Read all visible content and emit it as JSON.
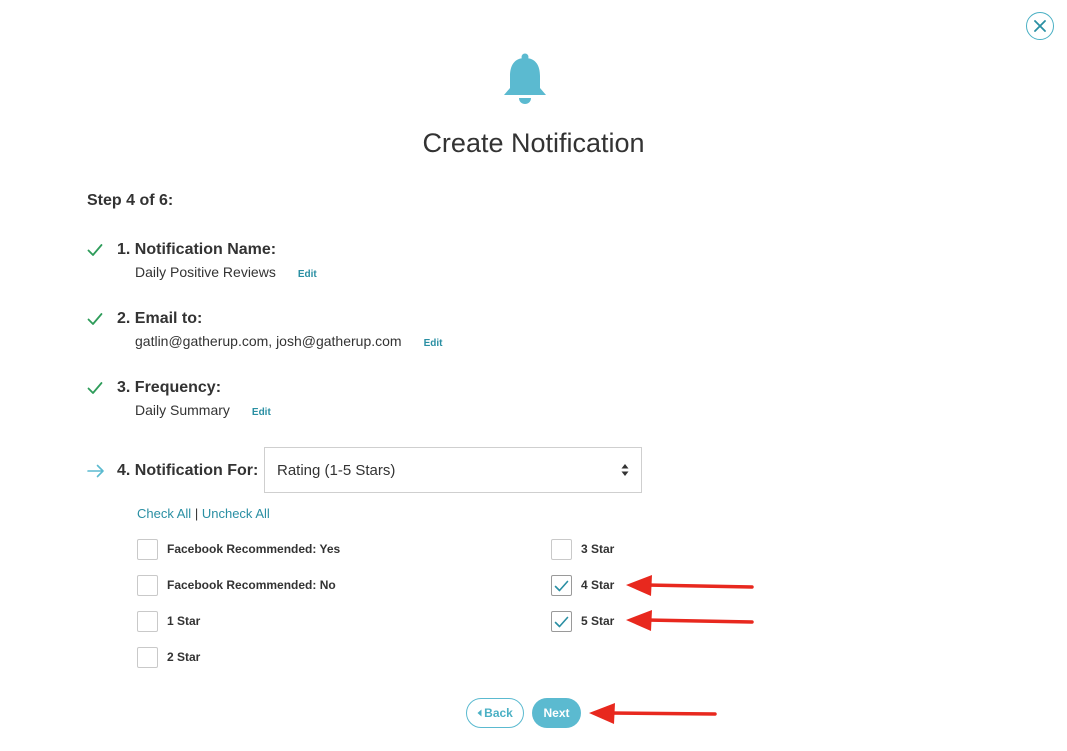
{
  "modal": {
    "title": "Create Notification",
    "step_label": "Step 4 of 6:"
  },
  "steps": [
    {
      "heading": "1. Notification Name:",
      "detail": "Daily Positive Reviews",
      "edit_label": "Edit",
      "status": "complete"
    },
    {
      "heading": "2. Email to:",
      "detail": "gatlin@gatherup.com, josh@gatherup.com",
      "edit_label": "Edit",
      "status": "complete"
    },
    {
      "heading": "3. Frequency:",
      "detail": "Daily Summary",
      "edit_label": "Edit",
      "status": "complete"
    },
    {
      "heading": "4. Notification For:",
      "status": "current"
    }
  ],
  "notification_for": {
    "selected": "Rating (1-5 Stars)"
  },
  "check_links": {
    "check_all": "Check All",
    "separator": "|",
    "uncheck_all": "Uncheck All"
  },
  "options": [
    {
      "label": "Facebook Recommended: Yes",
      "checked": false
    },
    {
      "label": "Facebook Recommended: No",
      "checked": false
    },
    {
      "label": "1 Star",
      "checked": false
    },
    {
      "label": "2 Star",
      "checked": false
    },
    {
      "label": "3 Star",
      "checked": false
    },
    {
      "label": "4 Star",
      "checked": true
    },
    {
      "label": "5 Star",
      "checked": true
    }
  ],
  "buttons": {
    "back_label": "Back",
    "next_label": "Next"
  },
  "icons": {
    "close": "close-icon",
    "bell": "bell-icon",
    "step_complete": "checkmark-icon",
    "step_current": "arrow-right-icon",
    "select_caret": "sort-caret-icon",
    "back_caret": "caret-left-icon",
    "annotation": "red-arrow-annotation"
  },
  "colors": {
    "accent": "#5bbad0",
    "link": "#2a8fa3",
    "check_green": "#2e9c5a",
    "annotation_red": "#e8281e",
    "text": "#333333"
  }
}
